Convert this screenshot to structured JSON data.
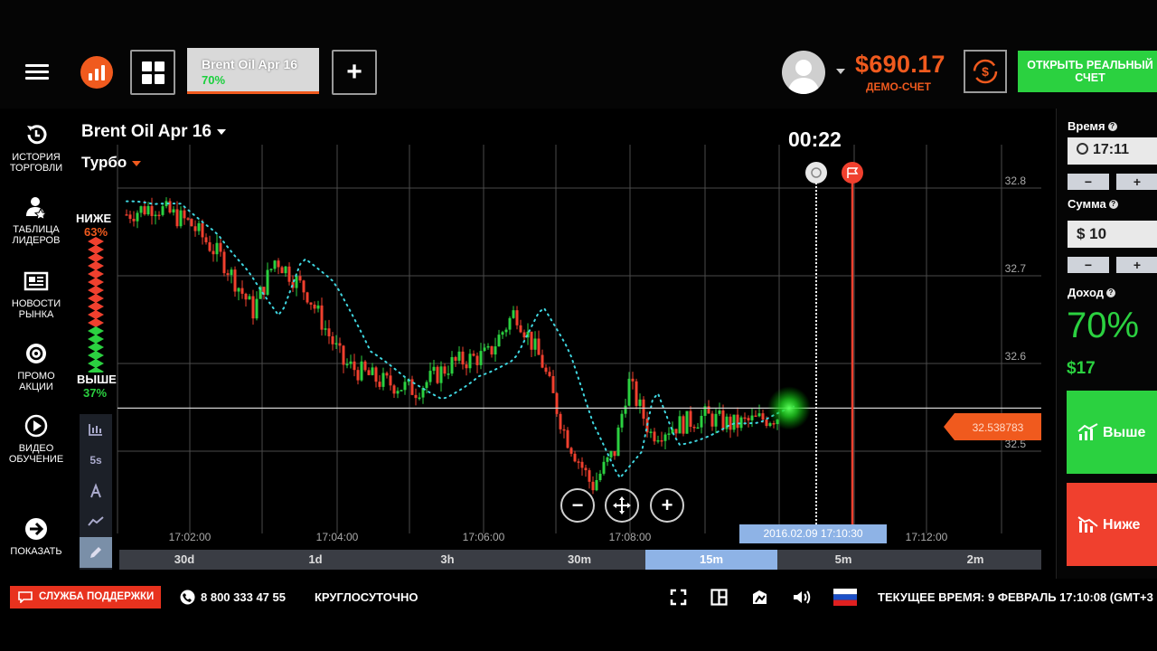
{
  "header": {
    "asset_tab_name": "Brent Oil Apr 16",
    "asset_tab_payout": "70%",
    "add_tab_symbol": "+",
    "balance": "$690.17",
    "account_type": "ДЕМО-СЧЕТ",
    "open_real_account": "ОТКРЫТЬ РЕАЛЬНЫЙ СЧЕТ"
  },
  "sidebar": {
    "items": [
      {
        "label": "ИСТОРИЯ ТОРГОВЛИ",
        "icon": "history-icon"
      },
      {
        "label": "ТАБЛИЦА ЛИДЕРОВ",
        "icon": "leaders-icon"
      },
      {
        "label": "НОВОСТИ РЫНКА",
        "icon": "news-icon"
      },
      {
        "label": "ПРОМО АКЦИИ",
        "icon": "promo-icon"
      },
      {
        "label": "ВИДЕО ОБУЧЕНИЕ",
        "icon": "video-icon"
      },
      {
        "label": "ПОКАЗАТЬ",
        "icon": "show-arrow-icon"
      }
    ]
  },
  "chart": {
    "asset": "Brent Oil Apr 16",
    "mode": "Турбо",
    "sentiment_lower_label": "НИЖЕ",
    "sentiment_lower_pct": "63%",
    "sentiment_higher_label": "ВЫШЕ",
    "sentiment_higher_pct": "37%",
    "countdown": "00:22",
    "current_price": "32.538783",
    "cursor_time": "2016.02.09 17:10:30",
    "tools": [
      "chart-type-icon",
      "5s",
      "indicator-icon",
      "line-tool-icon",
      "pencil-icon"
    ],
    "tool_5s_label": "5s",
    "zoom_out": "−",
    "zoom_in": "+"
  },
  "chart_data": {
    "type": "candlestick",
    "title": "Brent Oil Apr 16",
    "y_ticks": [
      "32.8",
      "32.7",
      "32.6",
      "32.5"
    ],
    "x_ticks": [
      "17:02:00",
      "17:04:00",
      "17:06:00",
      "17:08:00",
      "17:12:00"
    ],
    "ylim": [
      32.44,
      32.84
    ],
    "current_price": 32.538783,
    "expiration_time": "17:11",
    "grid": true,
    "indicator": "dotted trailing line (cyan)"
  },
  "timeframes": [
    "30d",
    "1d",
    "3h",
    "30m",
    "15m",
    "5m",
    "2m"
  ],
  "timeframe_selected": "15m",
  "right_panel": {
    "time_label": "Время",
    "time_value": "17:11",
    "amount_label": "Сумма",
    "amount_value": "$ 10",
    "minus": "−",
    "plus": "+",
    "income_label": "Доход",
    "income_pct": "70%",
    "income_value": "$17",
    "higher_button": "Выше",
    "lower_button": "Ниже"
  },
  "footer": {
    "support": "СЛУЖБА ПОДДЕРЖКИ",
    "phone": "8 800 333 47 55",
    "hours": "КРУГЛОСУТОЧНО",
    "current_time": "ТЕКУЩЕЕ ВРЕМЯ: 9 ФЕВРАЛЬ 17:10:08 (GMT+3"
  },
  "colors": {
    "accent_orange": "#f05a1e",
    "green": "#2bd140",
    "red": "#f0402e",
    "selected_timeframe": "#8eb3e6"
  }
}
